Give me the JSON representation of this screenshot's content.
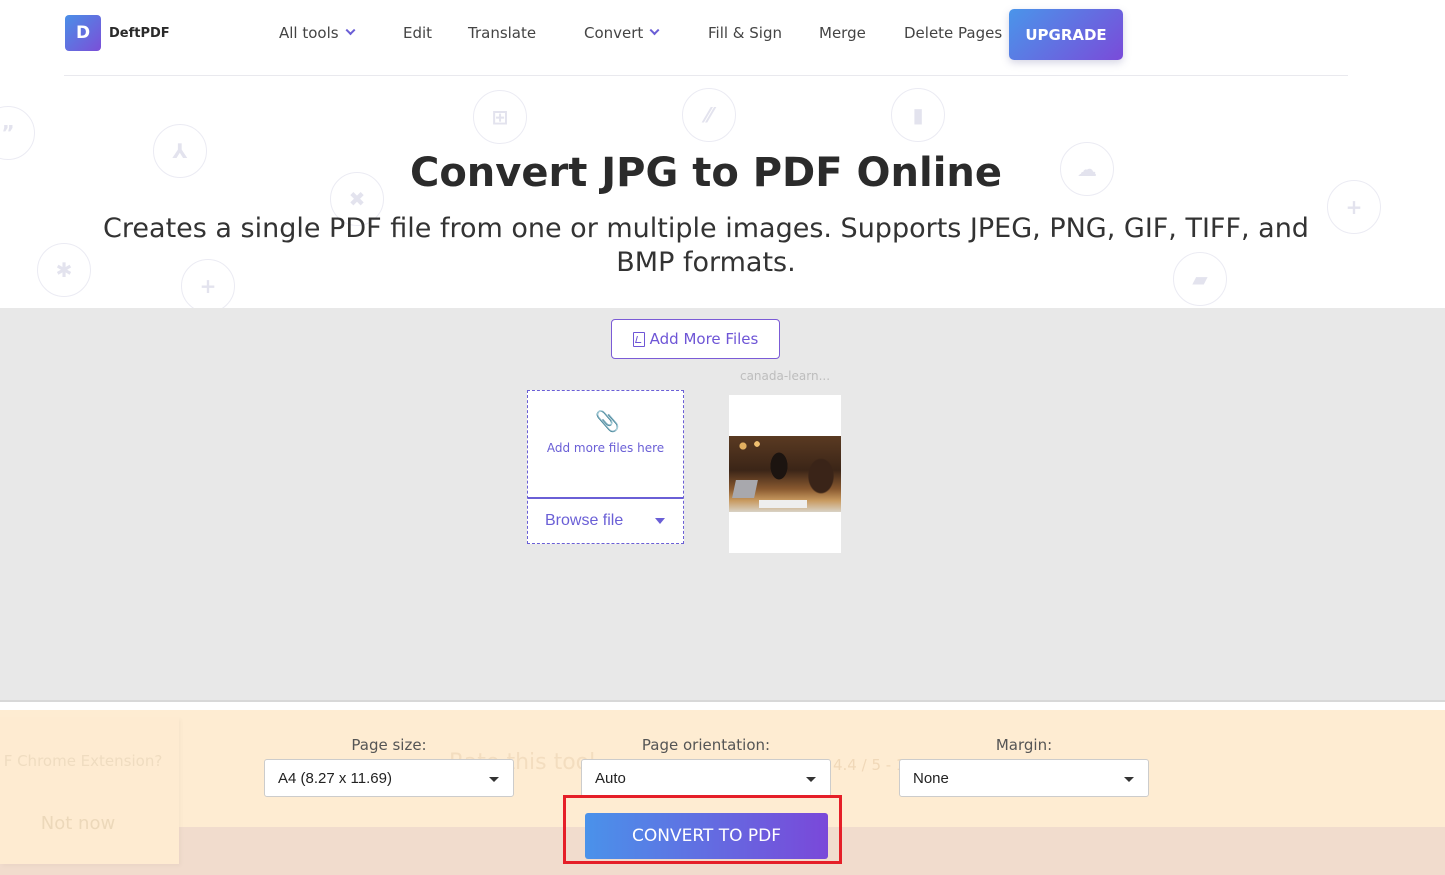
{
  "header": {
    "logo_letter": "D",
    "logo_text": "DeftPDF",
    "nav": [
      {
        "label": "All tools",
        "has_dropdown": true
      },
      {
        "label": "Edit",
        "has_dropdown": false
      },
      {
        "label": "Translate",
        "has_dropdown": false
      },
      {
        "label": "Convert",
        "has_dropdown": true
      },
      {
        "label": "Fill & Sign",
        "has_dropdown": false
      },
      {
        "label": "Merge",
        "has_dropdown": false
      },
      {
        "label": "Delete Pages",
        "has_dropdown": false
      }
    ],
    "upgrade_label": "UPGRADE"
  },
  "hero": {
    "title": "Convert JPG to PDF Online",
    "subtitle": "Creates a single PDF file from one or multiple images. Supports JPEG, PNG, GIF, TIFF, and BMP formats.",
    "background_icons": [
      "quote-icon",
      "merge-icon",
      "delete-icon",
      "puzzle-icon",
      "add-comment-icon",
      "grid-icon",
      "stripes-icon",
      "bookmark-icon",
      "cloud-icon",
      "add-comment-icon",
      "cards-icon"
    ]
  },
  "upload": {
    "add_more_label": "Add More Files",
    "dropzone_text": "Add more files here",
    "browse_label": "Browse file",
    "files": [
      {
        "name": "canada-learn..."
      }
    ]
  },
  "options": {
    "page_size": {
      "label": "Page size:",
      "value": "A4 (8.27 x 11.69)"
    },
    "orientation": {
      "label": "Page orientation:",
      "value": "Auto"
    },
    "margin": {
      "label": "Margin:",
      "value": "None"
    },
    "convert_label": "CONVERT TO PDF",
    "rate_text": "Rate this tool",
    "rate_score": "4.4 / 5 - 1"
  },
  "extension_popup": {
    "question": "F Chrome Extension?",
    "dismiss_label": "Not now"
  },
  "colors": {
    "brand_gradient_start": "#4a92ea",
    "brand_gradient_end": "#7a48d9",
    "accent_purple": "#6a5fd6",
    "options_bg": "#feecd2",
    "highlight_red": "#e51f28"
  }
}
